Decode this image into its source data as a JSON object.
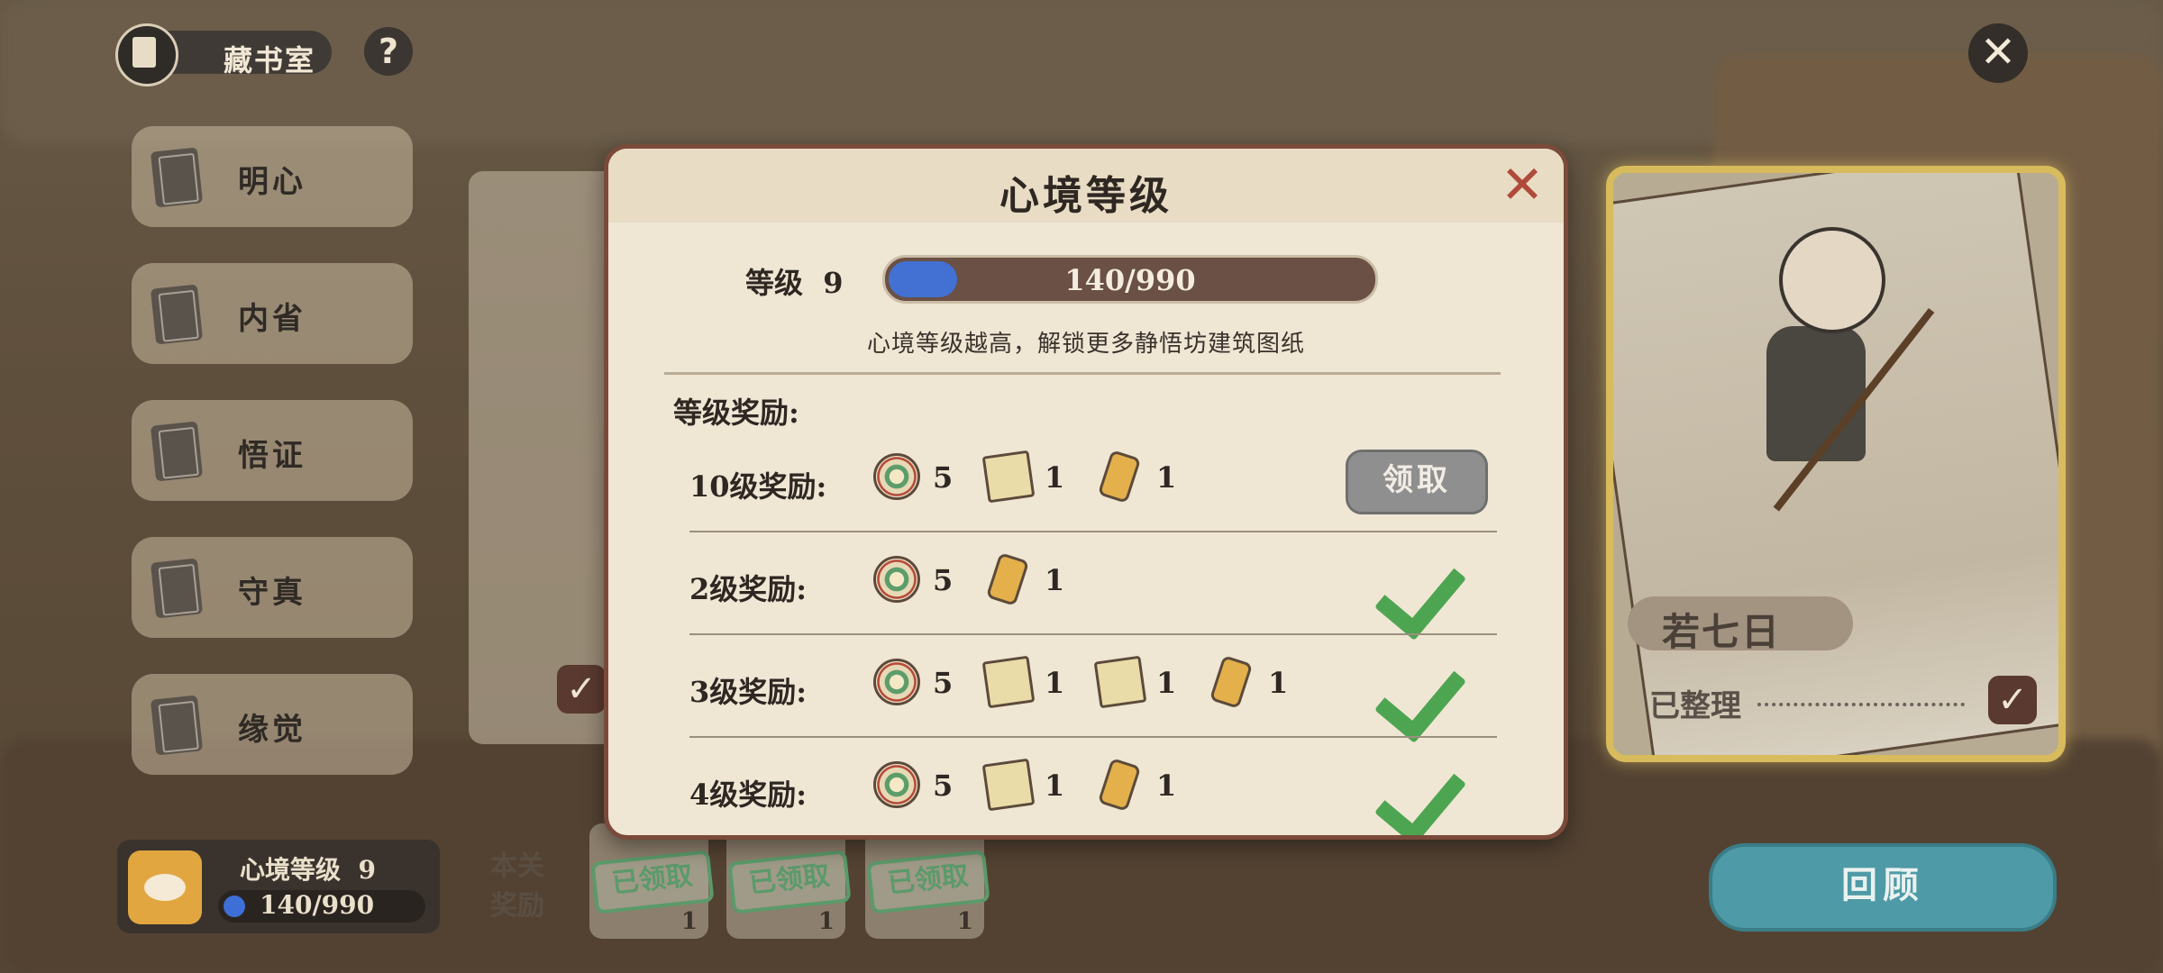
{
  "room": {
    "title": "藏书室",
    "help_icon": "question-icon",
    "close_icon": "close-icon"
  },
  "menu": {
    "items": [
      {
        "label": "明心"
      },
      {
        "label": "内省"
      },
      {
        "label": "悟证"
      },
      {
        "label": "守真"
      },
      {
        "label": "缘觉"
      }
    ]
  },
  "character_card": {
    "name": "若七日",
    "status": "已整理",
    "checked": true
  },
  "status": {
    "label": "心境等级",
    "level": "9",
    "progress": "140/990"
  },
  "stage_reward": {
    "label_line1": "本关",
    "label_line2": "奖励",
    "slots": [
      {
        "stamp": "已领取",
        "count": "1"
      },
      {
        "stamp": "已领取",
        "count": "1"
      },
      {
        "stamp": "已领取",
        "count": "1"
      }
    ]
  },
  "review_button": "回顾",
  "modal": {
    "title": "心境等级",
    "level_label": "等级",
    "level": "9",
    "progress_text": "140/990",
    "progress_fraction": 0.141,
    "hint": "心境等级越高，解锁更多静悟坊建筑图纸",
    "rewards_title": "等级奖励:",
    "rows": [
      {
        "label": "10级奖励:",
        "items": [
          {
            "icon": "coin-icon",
            "count": "5"
          },
          {
            "icon": "paper-icon",
            "count": "1"
          },
          {
            "icon": "scroll-icon",
            "count": "1"
          }
        ],
        "action": "领取",
        "claimed": false
      },
      {
        "label": "2级奖励:",
        "items": [
          {
            "icon": "coin-icon",
            "count": "5"
          },
          {
            "icon": "scroll-icon",
            "count": "1"
          }
        ],
        "claimed": true
      },
      {
        "label": "3级奖励:",
        "items": [
          {
            "icon": "coin-icon",
            "count": "5"
          },
          {
            "icon": "paper-icon",
            "count": "1"
          },
          {
            "icon": "paper-icon",
            "count": "1"
          },
          {
            "icon": "scroll-icon",
            "count": "1"
          }
        ],
        "claimed": true
      },
      {
        "label": "4级奖励:",
        "items": [
          {
            "icon": "coin-icon",
            "count": "5"
          },
          {
            "icon": "paper-icon",
            "count": "1"
          },
          {
            "icon": "scroll-icon",
            "count": "1"
          }
        ],
        "claimed": true
      }
    ]
  },
  "colors": {
    "progress_blue": "#4271d3",
    "check_green": "#4ea551",
    "review_teal": "#4e9aa6",
    "gold_border": "#d8bb5c"
  }
}
